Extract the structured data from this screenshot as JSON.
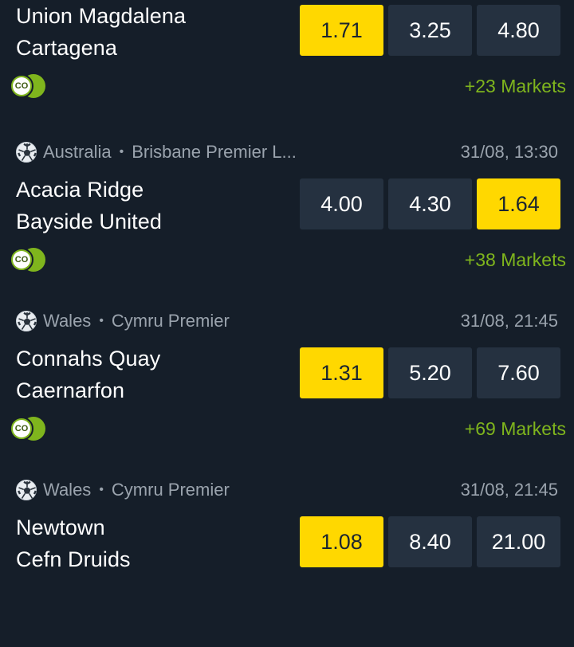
{
  "events": [
    {
      "country": "",
      "league": "",
      "datetime": "",
      "home": "Union Magdalena",
      "away": "Cartagena",
      "odds": [
        "1.71",
        "3.25",
        "4.80"
      ],
      "selected_index": 0,
      "badge": "CO",
      "markets": "+23 Markets"
    },
    {
      "country": "Australia",
      "league": "Brisbane Premier L...",
      "datetime": "31/08, 13:30",
      "home": "Acacia Ridge",
      "away": "Bayside United",
      "odds": [
        "4.00",
        "4.30",
        "1.64"
      ],
      "selected_index": 2,
      "badge": "CO",
      "markets": "+38 Markets"
    },
    {
      "country": "Wales",
      "league": "Cymru Premier",
      "datetime": "31/08, 21:45",
      "home": "Connahs Quay",
      "away": "Caernarfon",
      "odds": [
        "1.31",
        "5.20",
        "7.60"
      ],
      "selected_index": 0,
      "badge": "CO",
      "markets": "+69 Markets"
    },
    {
      "country": "Wales",
      "league": "Cymru Premier",
      "datetime": "31/08, 21:45",
      "home": "Newtown",
      "away": "Cefn Druids",
      "odds": [
        "1.08",
        "8.40",
        "21.00"
      ],
      "selected_index": 0,
      "badge": "",
      "markets": ""
    }
  ],
  "icons": {
    "sport": "soccer-ball-icon",
    "badge": "cashout-co-icon"
  },
  "colors": {
    "background": "#151e29",
    "odd_button": "#253140",
    "selected": "#ffd800",
    "accent_green": "#7fb51d"
  }
}
